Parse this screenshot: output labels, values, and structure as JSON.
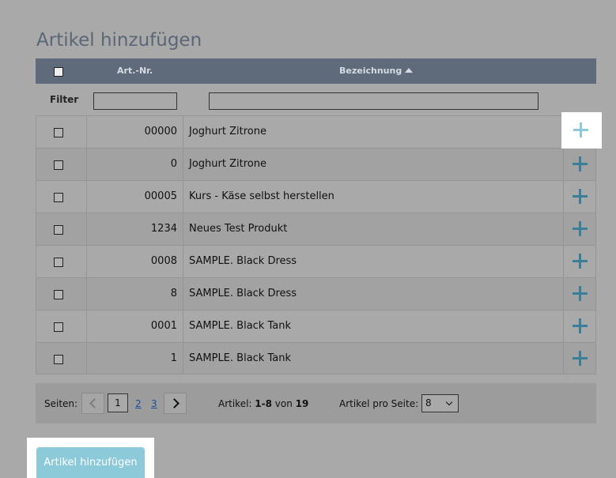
{
  "title": "Artikel hinzufügen",
  "header": {
    "col_artnr": "Art.-Nr.",
    "col_bezeichnung": "Bezeichnung"
  },
  "filter": {
    "label": "Filter",
    "artnr_value": "",
    "bezeichnung_value": ""
  },
  "rows": [
    {
      "artnr": "00000",
      "name": "Joghurt Zitrone"
    },
    {
      "artnr": "0",
      "name": "Joghurt Zitrone"
    },
    {
      "artnr": "00005",
      "name": "Kurs - Käse selbst herstellen"
    },
    {
      "artnr": "1234",
      "name": "Neues Test Produkt"
    },
    {
      "artnr": "0008",
      "name": "SAMPLE. Black Dress"
    },
    {
      "artnr": "8",
      "name": "SAMPLE. Black Dress"
    },
    {
      "artnr": "0001",
      "name": "SAMPLE. Black Tank"
    },
    {
      "artnr": "1",
      "name": "SAMPLE. Black Tank"
    }
  ],
  "pager": {
    "pages_label": "Seiten:",
    "current_page": "1",
    "page_2": "2",
    "page_3": "3",
    "count_prefix": "Artikel: ",
    "count_range": "1-8",
    "count_of": " von ",
    "count_total": "19",
    "per_page_label": "Artikel pro Seite:",
    "per_page_value": "8"
  },
  "submit_label": "Artikel hinzufügen",
  "colors": {
    "accent": "#8cc9d9",
    "plus": "#3a7f9a",
    "header_bg": "#5f6b7a"
  }
}
